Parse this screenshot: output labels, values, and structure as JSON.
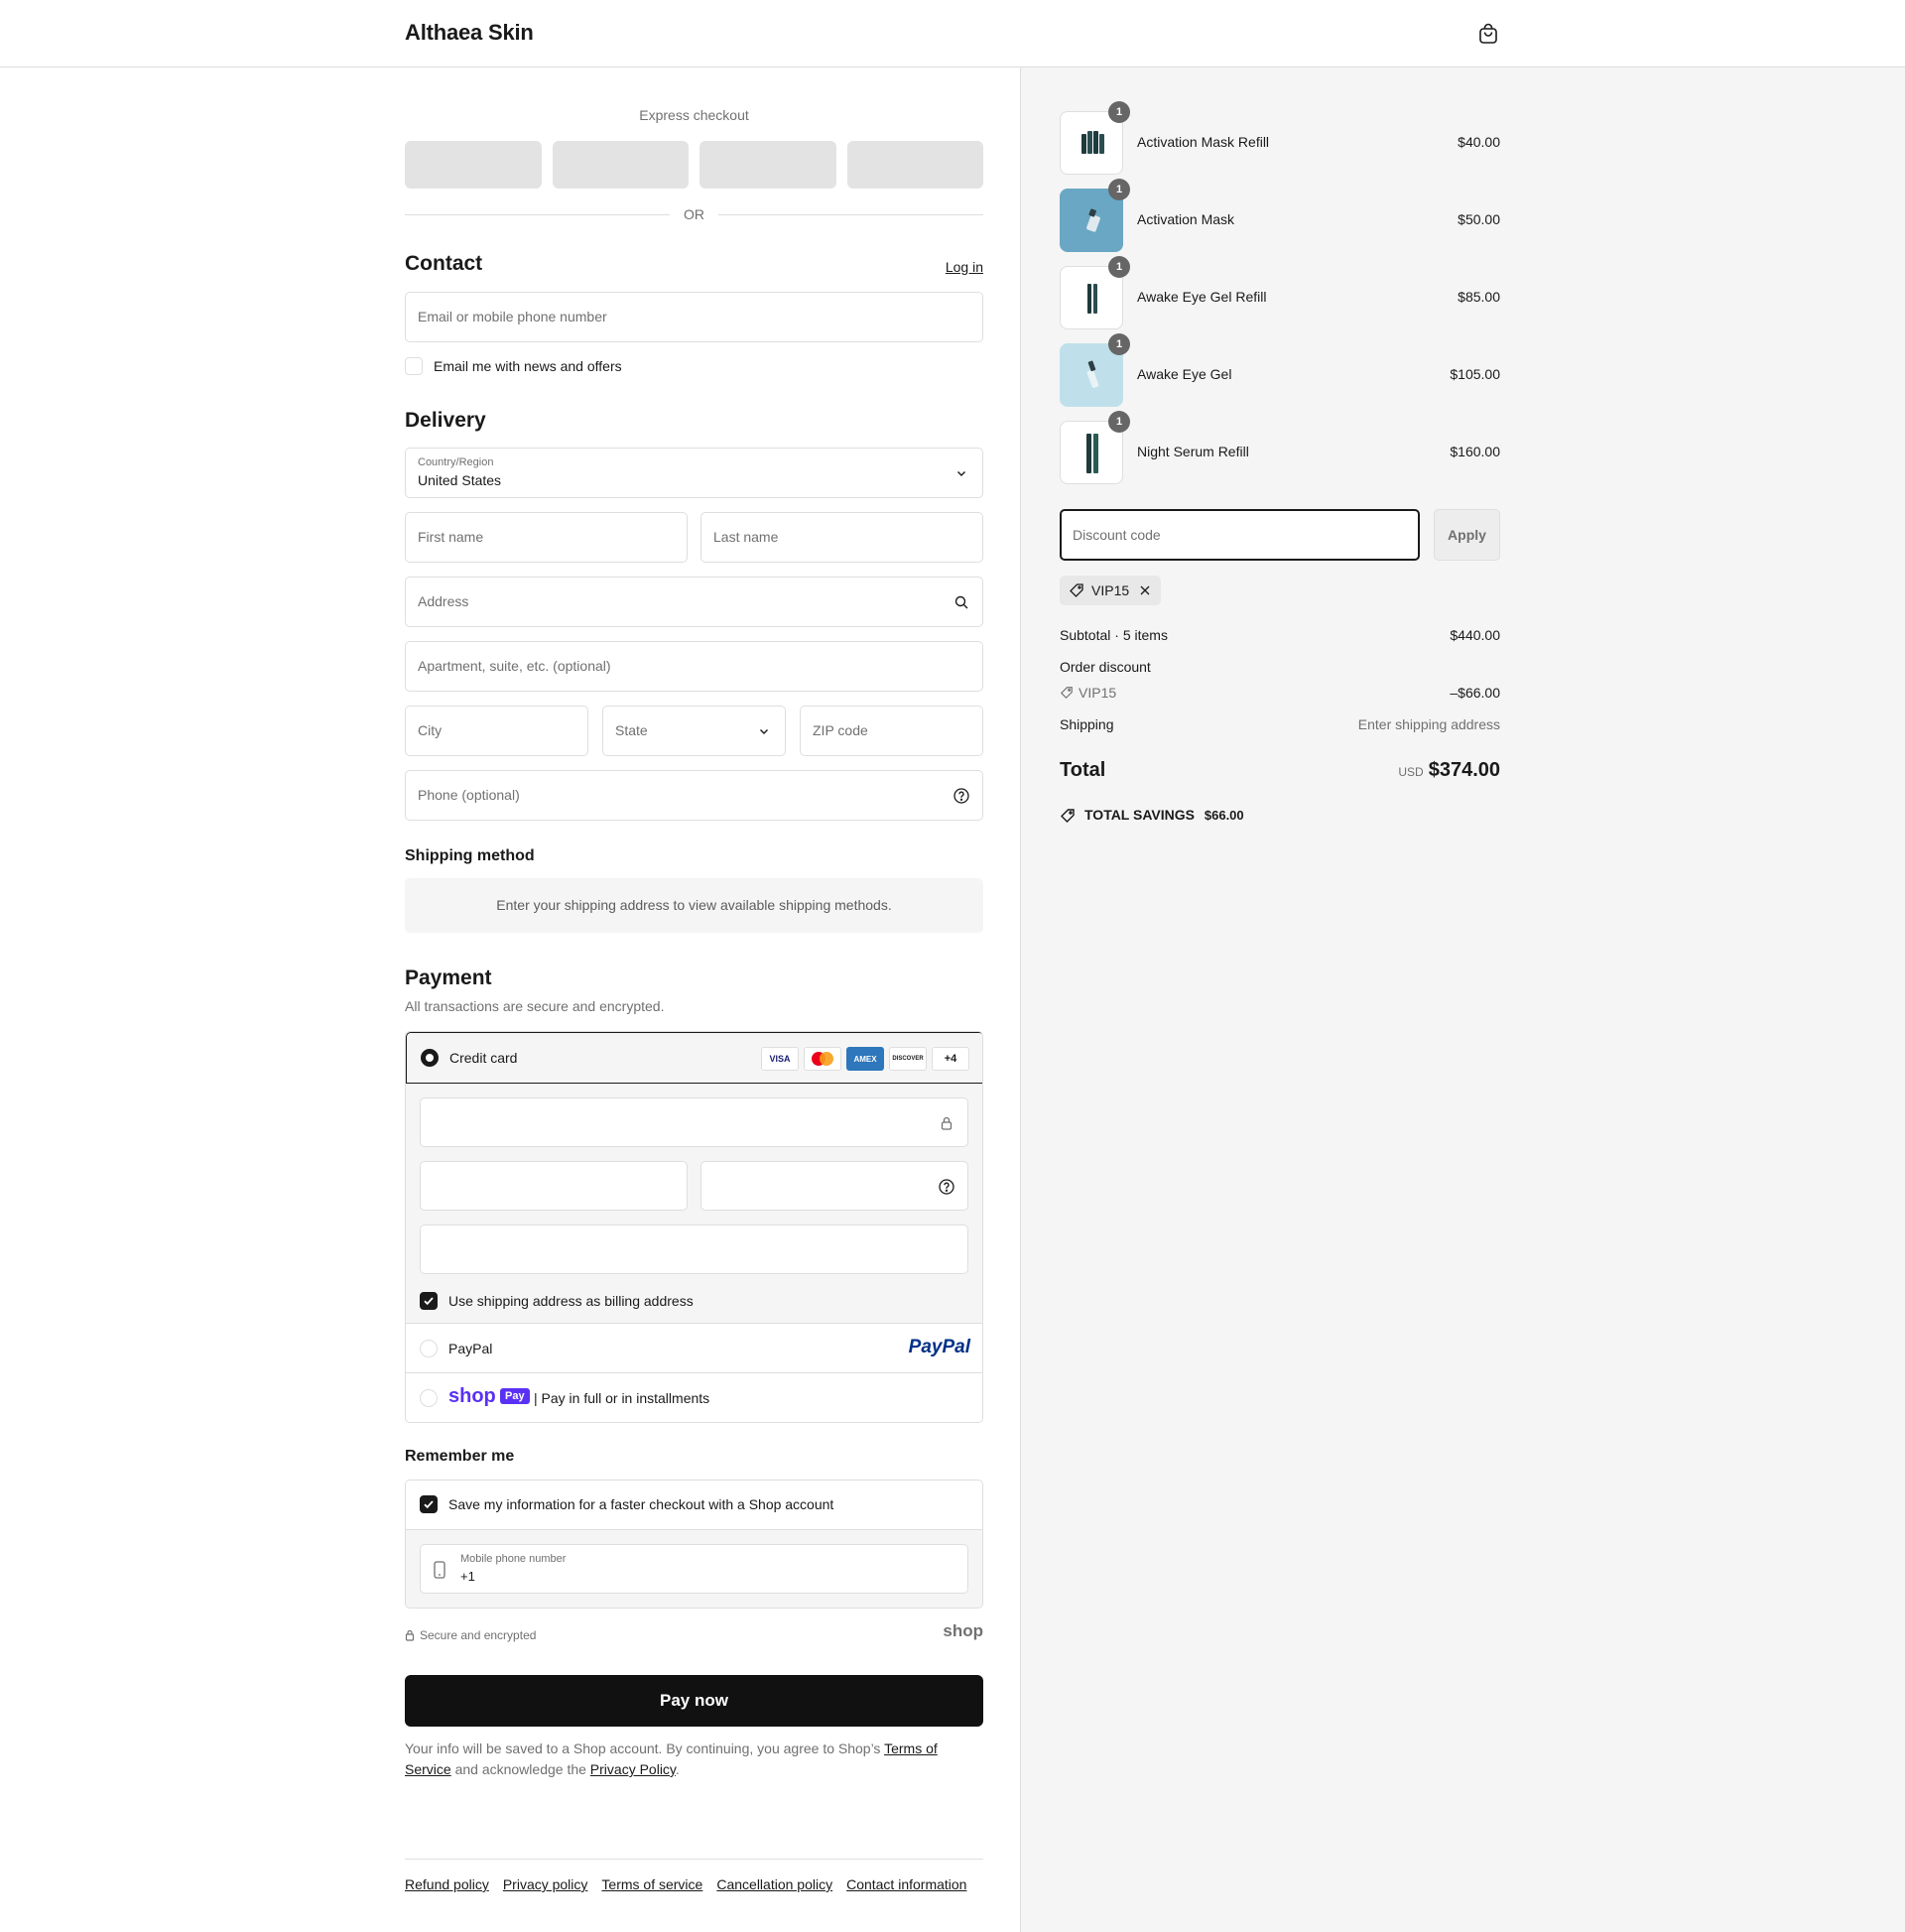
{
  "header": {
    "brand": "Althaea Skin"
  },
  "express": {
    "title": "Express checkout",
    "or": "OR"
  },
  "contact": {
    "title": "Contact",
    "login": "Log in",
    "email_placeholder": "Email or mobile phone number",
    "news_label": "Email me with news and offers"
  },
  "delivery": {
    "title": "Delivery",
    "country_label": "Country/Region",
    "country_value": "United States",
    "first_name": "First name",
    "last_name": "Last name",
    "address": "Address",
    "apartment": "Apartment, suite, etc. (optional)",
    "city": "City",
    "state": "State",
    "zip": "ZIP code",
    "phone": "Phone (optional)"
  },
  "shipping": {
    "title": "Shipping method",
    "notice": "Enter your shipping address to view available shipping methods."
  },
  "payment": {
    "title": "Payment",
    "subtitle": "All transactions are secure and encrypted.",
    "credit_card": "Credit card",
    "cards": [
      "VISA",
      "",
      "AMEX",
      "DISCOVER",
      "+4"
    ],
    "billing_same": "Use shipping address as billing address",
    "paypal": "PayPal",
    "paypal_logo": "PayPal",
    "shop_logo": "shop",
    "shop_pay_badge": "Pay",
    "shop_pay_text": "| Pay in full or in installments"
  },
  "remember": {
    "title": "Remember me",
    "save_label": "Save my information for a faster checkout with a Shop account",
    "mobile_label": "Mobile phone number",
    "mobile_value": "+1",
    "secure": "Secure and encrypted",
    "shop_logo": "shop"
  },
  "pay_now": "Pay now",
  "legal": {
    "text1": "Your info will be saved to a Shop account. By continuing, you agree to Shop’s ",
    "terms": "Terms of Service",
    "text2": " and acknowledge the ",
    "privacy": "Privacy Policy",
    "text3": "."
  },
  "footer": {
    "links": [
      "Refund policy",
      "Privacy policy",
      "Terms of service",
      "Cancellation policy",
      "Contact information"
    ]
  },
  "cart": {
    "items": [
      {
        "name": "Activation Mask Refill",
        "price": "$40.00",
        "qty": "1"
      },
      {
        "name": "Activation Mask",
        "price": "$50.00",
        "qty": "1"
      },
      {
        "name": "Awake Eye Gel Refill",
        "price": "$85.00",
        "qty": "1"
      },
      {
        "name": "Awake Eye Gel",
        "price": "$105.00",
        "qty": "1"
      },
      {
        "name": "Night Serum Refill",
        "price": "$160.00",
        "qty": "1"
      }
    ],
    "discount_placeholder": "Discount code",
    "apply": "Apply",
    "applied_code": "VIP15",
    "subtotal_label": "Subtotal · 5 items",
    "subtotal_value": "$440.00",
    "order_discount_label": "Order discount",
    "discount_code": "VIP15",
    "discount_value": "–$66.00",
    "shipping_label": "Shipping",
    "shipping_value": "Enter shipping address",
    "total_label": "Total",
    "currency": "USD",
    "total_value": "$374.00",
    "savings_label": "TOTAL SAVINGS",
    "savings_value": "$66.00"
  },
  "colors": {
    "accent": "#1a1a1a",
    "shop_purple": "#5a31f4",
    "paypal_blue": "#003087"
  }
}
